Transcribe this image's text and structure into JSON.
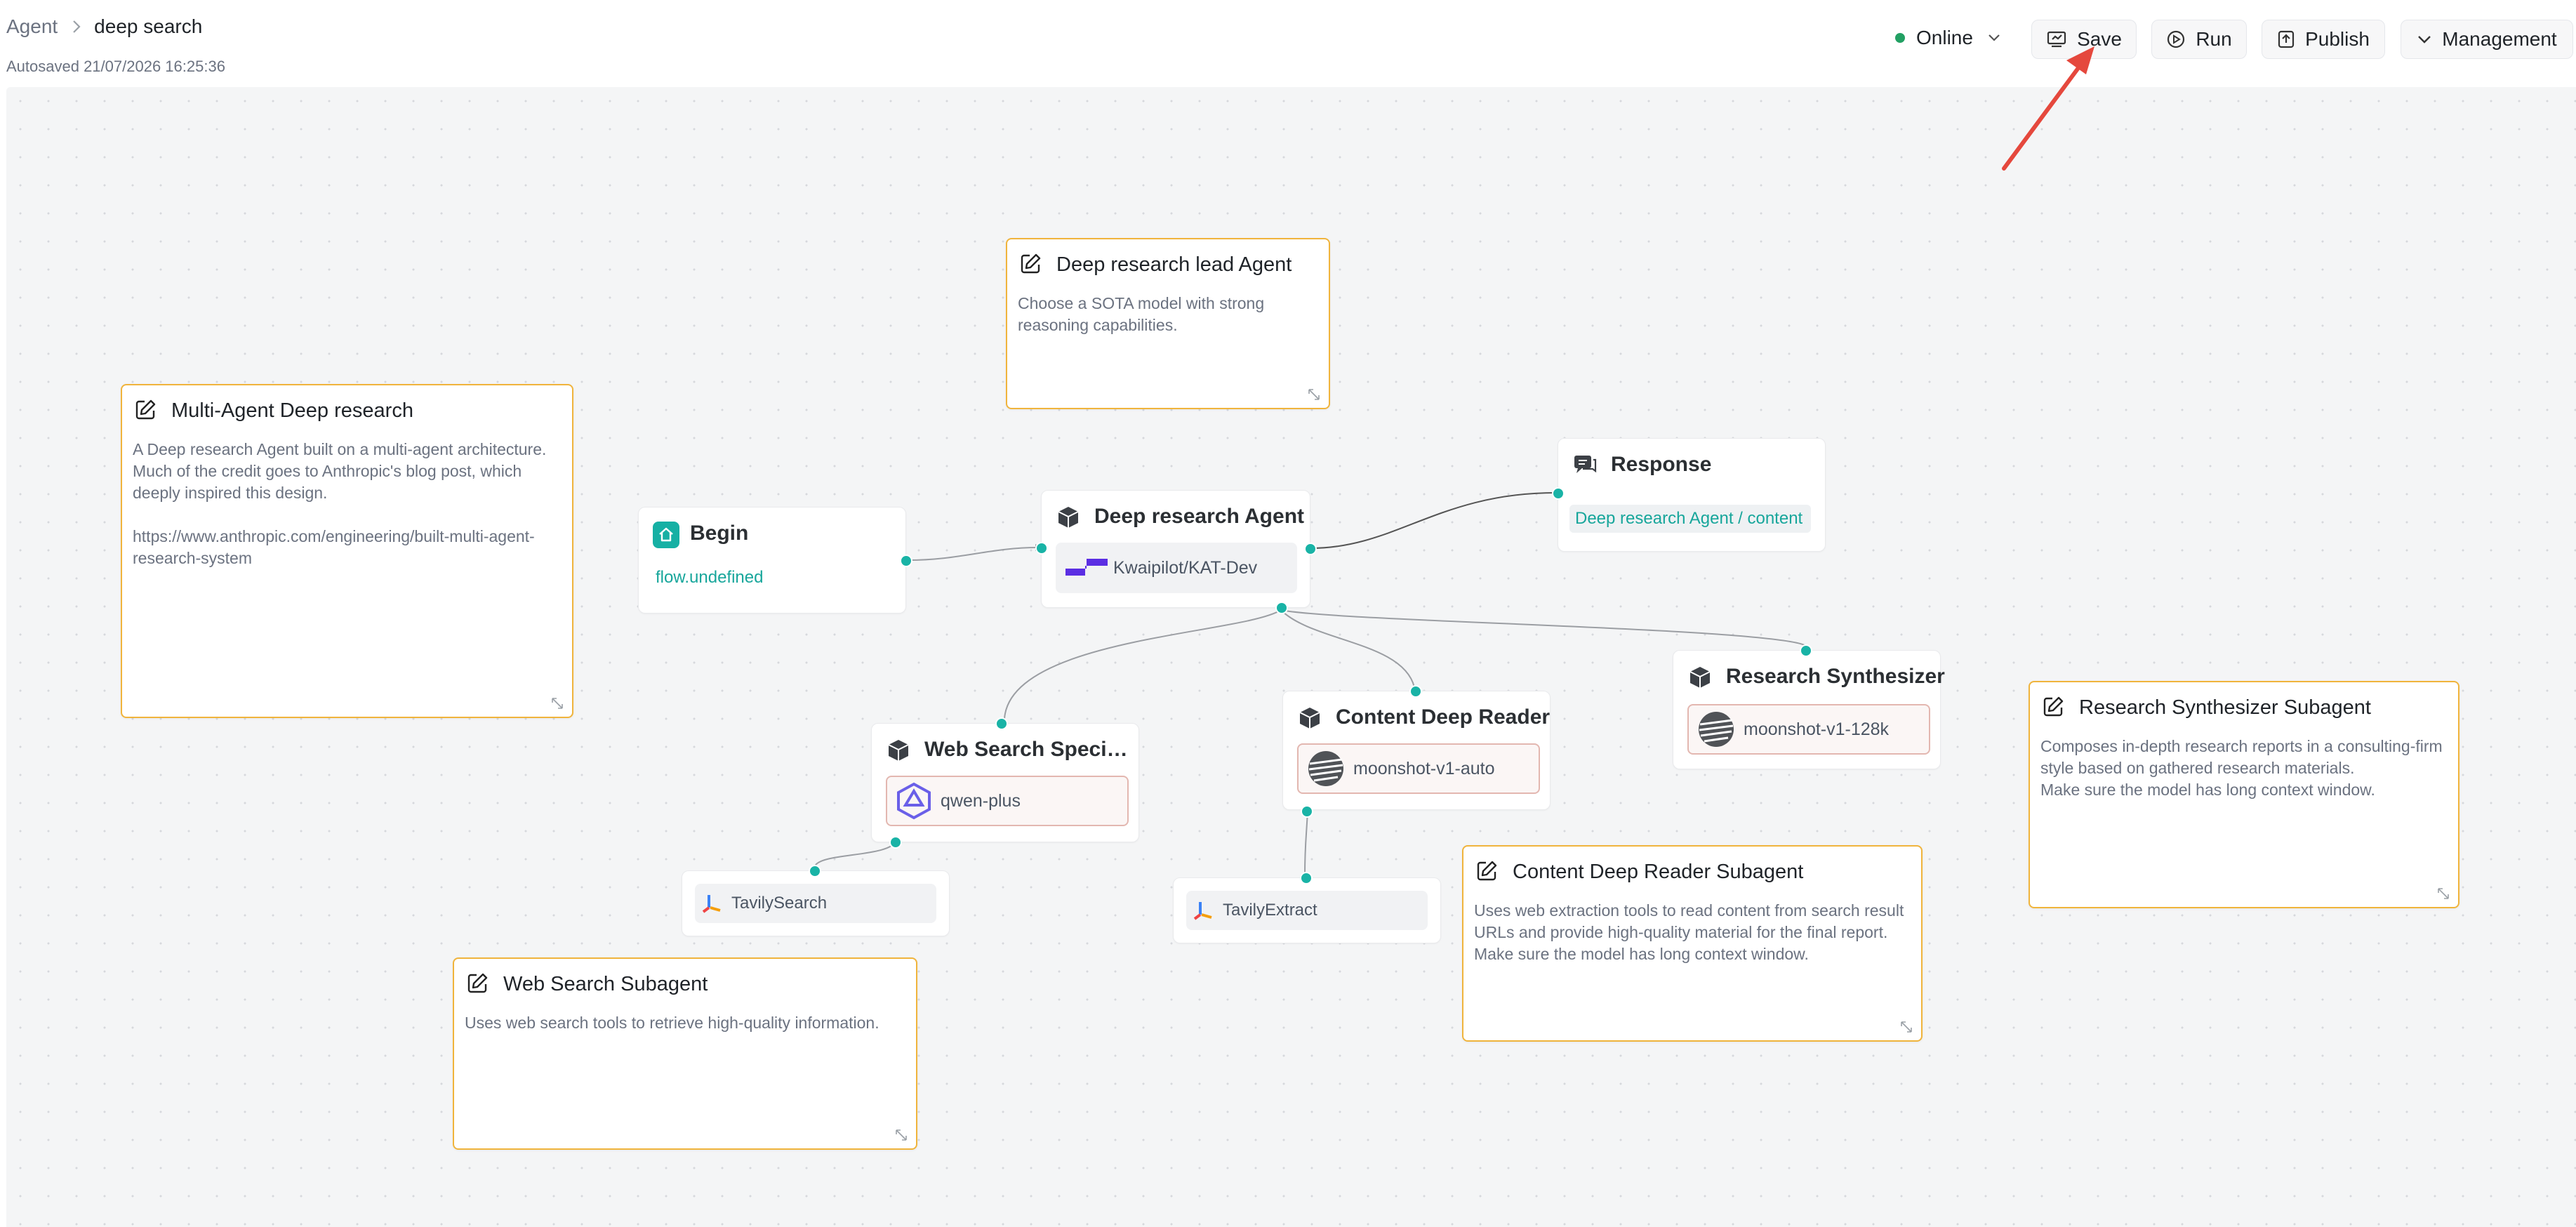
{
  "header": {
    "breadcrumb_root": "Agent",
    "breadcrumb_current": "deep search",
    "autosaved": "Autosaved 21/07/2026 16:25:36",
    "status": "Online",
    "buttons": {
      "save": "Save",
      "run": "Run",
      "publish": "Publish",
      "management": "Management"
    }
  },
  "notes": {
    "multi_agent": {
      "title": "Multi-Agent Deep research",
      "body": "A Deep research Agent built on a multi-agent architecture.\nMuch of the credit goes to Anthropic's blog post, which deeply inspired this design.\n\nhttps://www.anthropic.com/engineering/built-multi-agent-research-system"
    },
    "lead_agent": {
      "title": "Deep research lead Agent",
      "body": "Choose a SOTA model with strong reasoning capabilities."
    },
    "web_search": {
      "title": "Web Search Subagent",
      "body": "Uses web search tools to retrieve high-quality information."
    },
    "content_reader": {
      "title": "Content Deep Reader Subagent",
      "body": "Uses web extraction tools to read content from search result URLs and provide high-quality material for the final report.\nMake sure the model has long context window."
    },
    "synthesizer": {
      "title": "Research Synthesizer Subagent",
      "body": "Composes in-depth research reports in a consulting-firm style based on gathered research materials.\nMake sure the model has long context window."
    }
  },
  "nodes": {
    "begin": {
      "title": "Begin",
      "output": "flow.undefined"
    },
    "agent": {
      "title": "Deep research Agent",
      "model": "Kwaipilot/KAT-Dev"
    },
    "response": {
      "title": "Response",
      "content": "Deep research Agent / content"
    },
    "synthesizer": {
      "title": "Research Synthesizer",
      "model": "moonshot-v1-128k"
    },
    "web_search": {
      "title": "Web Search Special...",
      "model": "qwen-plus"
    },
    "content_reader": {
      "title": "Content Deep Reader",
      "model": "moonshot-v1-auto"
    },
    "tavily_search": {
      "label": "TavilySearch"
    },
    "tavily_extract": {
      "label": "TavilyExtract"
    }
  },
  "colors": {
    "accent_teal": "#19b3a6",
    "note_border": "#f0b43c",
    "status_online": "#22a063",
    "annotation_arrow": "#e5483d"
  }
}
